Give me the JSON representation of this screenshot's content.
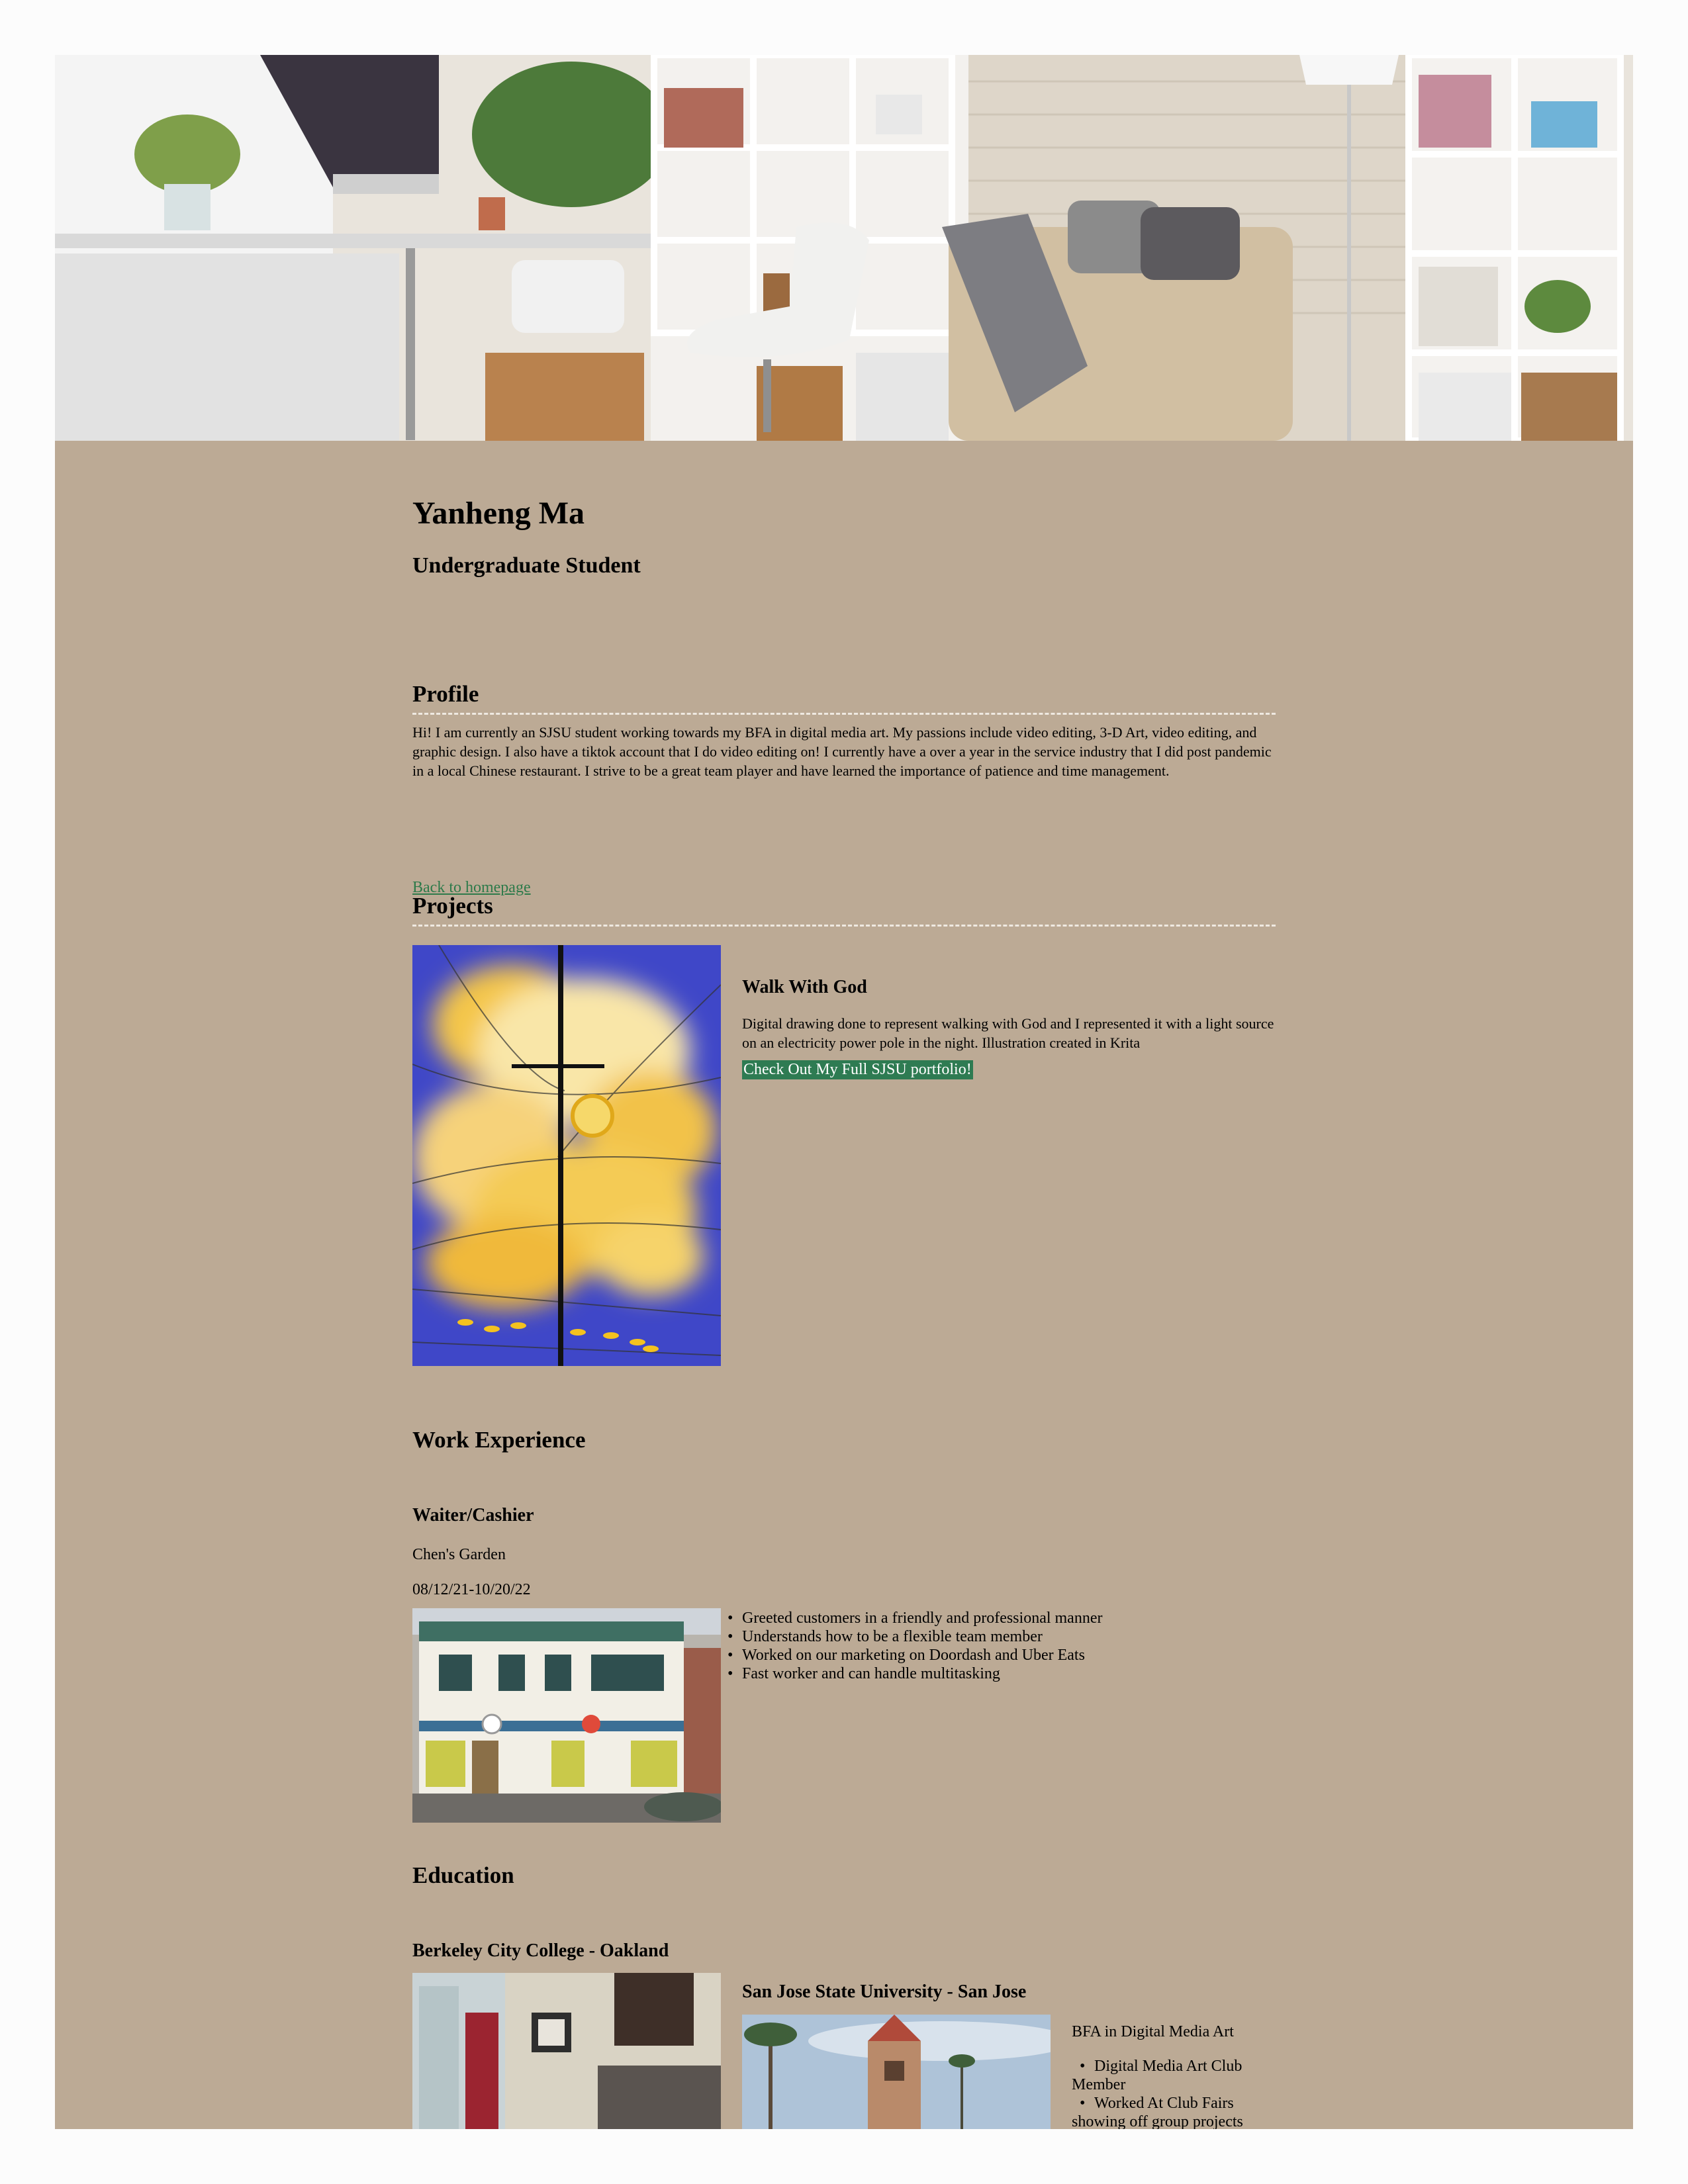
{
  "header": {
    "name": "Yanheng Ma",
    "subtitle": "Undergraduate Student"
  },
  "profile": {
    "title": "Profile",
    "text": "Hi! I am currently an SJSU student working towards my BFA in digital media art. My passions include video editing, 3-D Art, video editing, and graphic design. I also have a tiktok account that I do video editing on! I currently have a over a year in the service industry that I did post pandemic in a local Chinese restaurant. I strive to be a great team player and have learned the importance of patience and time management.",
    "back_link": "Back to homepage"
  },
  "projects": {
    "title": "Projects",
    "items": [
      {
        "title": "Walk With God",
        "description": "Digital drawing done to represent walking with God and I represented it with a light source on an electricity power pole in the night. Illustration created in Krita",
        "button": "Check Out My Full SJSU portfolio!"
      }
    ]
  },
  "work": {
    "title": "Work Experience",
    "jobs": [
      {
        "role": "Waiter/Cashier",
        "company": "Chen's Garden",
        "dates": "08/12/21-10/20/22",
        "duties": [
          "Greeted customers in a friendly and professional manner",
          "Understands how to be a flexible team member",
          "Worked on our marketing on Doordash and Uber Eats",
          "Fast worker and can handle multitasking"
        ]
      }
    ]
  },
  "education": {
    "title": "Education",
    "schools": [
      {
        "name": "Berkeley City College - Oakland"
      },
      {
        "name": "San Jose State University - San Jose",
        "degree": "BFA in Digital Media Art",
        "activities": [
          "Digital Media Art Club Member",
          "Worked At Club Fairs showing off group projects"
        ]
      }
    ]
  },
  "colors": {
    "page_background": "#bcaa95",
    "link": "#2d7a4a",
    "button_background": "#2e7b52",
    "rule": "#efe9e1"
  }
}
